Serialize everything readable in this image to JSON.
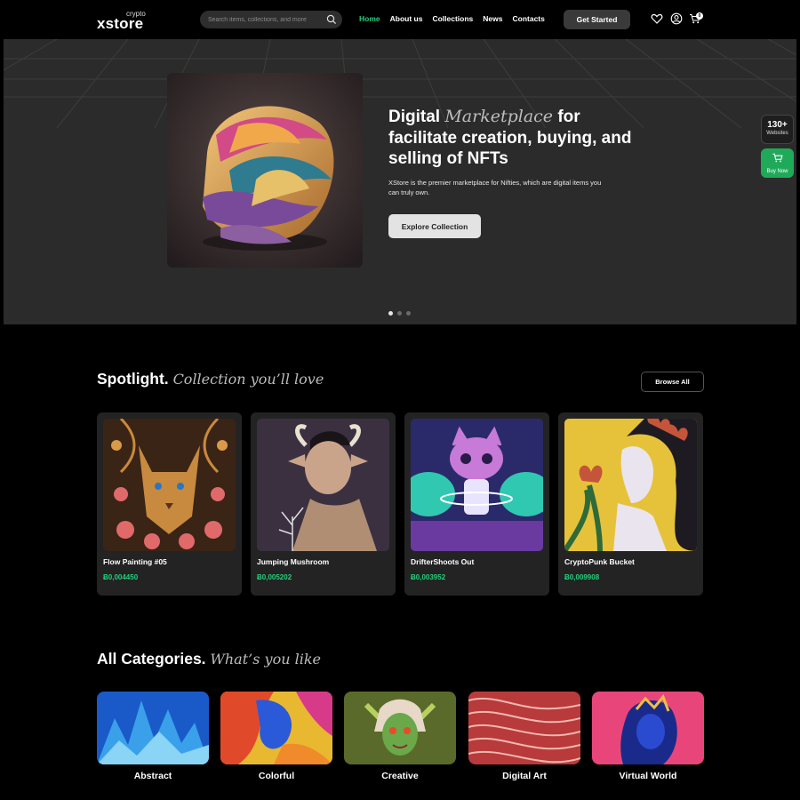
{
  "brand": {
    "sup": "crypto",
    "name": "xstore"
  },
  "search": {
    "placeholder": "Search items, collections, and more"
  },
  "nav": {
    "items": [
      {
        "label": "Home",
        "active": true
      },
      {
        "label": "About us"
      },
      {
        "label": "Collections"
      },
      {
        "label": "News"
      },
      {
        "label": "Contacts"
      }
    ],
    "cta": "Get Started",
    "cart_count": "0",
    "icons": [
      "heart-icon",
      "user-icon",
      "cart-icon"
    ]
  },
  "hero": {
    "title_pre": "Digital ",
    "title_ital": "Marketplace",
    "title_post": " for facilitate creation, buying, and selling of NFTs",
    "description": "XStore is the premier marketplace for Nifties, which are digital items you can truly own.",
    "button": "Explore Collection",
    "slides_total": 3,
    "active_slide": 1
  },
  "side": {
    "websites_count": "130+",
    "websites_label": "Websites",
    "buy_label": "Buy Now"
  },
  "spotlight": {
    "title": "Spotlight.",
    "subtitle": "Collection you’ll love",
    "browse": "Browse All",
    "cards": [
      {
        "name": "Flow Painting #05",
        "price": "Ƀ0,004450"
      },
      {
        "name": "Jumping Mushroom",
        "price": "Ƀ0,005202"
      },
      {
        "name": "DrifterShoots Out",
        "price": "Ƀ0,003952"
      },
      {
        "name": "CryptoPunk Bucket",
        "price": "Ƀ0,009908"
      }
    ]
  },
  "categories": {
    "title": "All Categories.",
    "subtitle": "What’s you like",
    "items": [
      {
        "label": "Abstract"
      },
      {
        "label": "Colorful"
      },
      {
        "label": "Creative"
      },
      {
        "label": "Digital Art"
      },
      {
        "label": "Virtual World"
      }
    ]
  },
  "colors": {
    "accent": "#22d07a",
    "background": "#000000",
    "hero_bg": "#2b2b2b",
    "card_bg": "#232323"
  }
}
